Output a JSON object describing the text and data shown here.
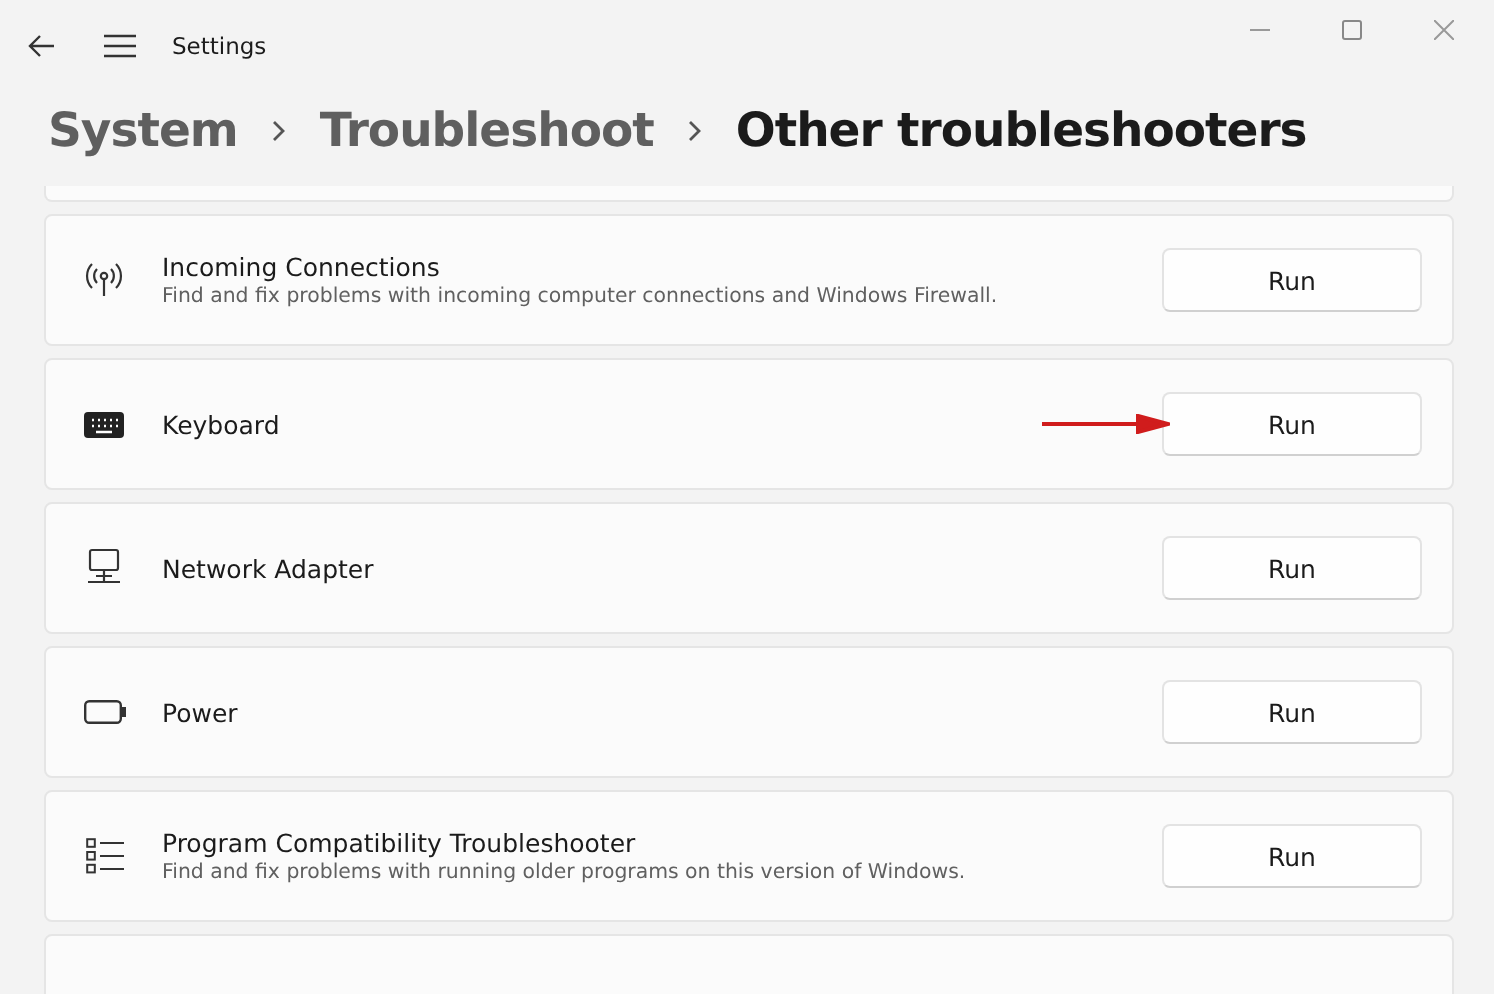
{
  "window": {
    "title": "Settings"
  },
  "breadcrumb": [
    {
      "label": "System",
      "current": false
    },
    {
      "label": "Troubleshoot",
      "current": false
    },
    {
      "label": "Other troubleshooters",
      "current": true
    }
  ],
  "troubleshooters": [
    {
      "kind": "antenna",
      "title": "Incoming Connections",
      "description": "Find and fix problems with incoming computer connections and Windows Firewall.",
      "button": "Run",
      "pointer_arrow": false
    },
    {
      "kind": "keyboard",
      "title": "Keyboard",
      "button": "Run",
      "pointer_arrow": true
    },
    {
      "kind": "monitor",
      "title": "Network Adapter",
      "button": "Run",
      "pointer_arrow": false
    },
    {
      "kind": "battery",
      "title": "Power",
      "button": "Run",
      "pointer_arrow": false
    },
    {
      "kind": "list",
      "title": "Program Compatibility Troubleshooter",
      "description": "Find and fix problems with running older programs on this version of Windows.",
      "button": "Run",
      "pointer_arrow": false
    }
  ]
}
